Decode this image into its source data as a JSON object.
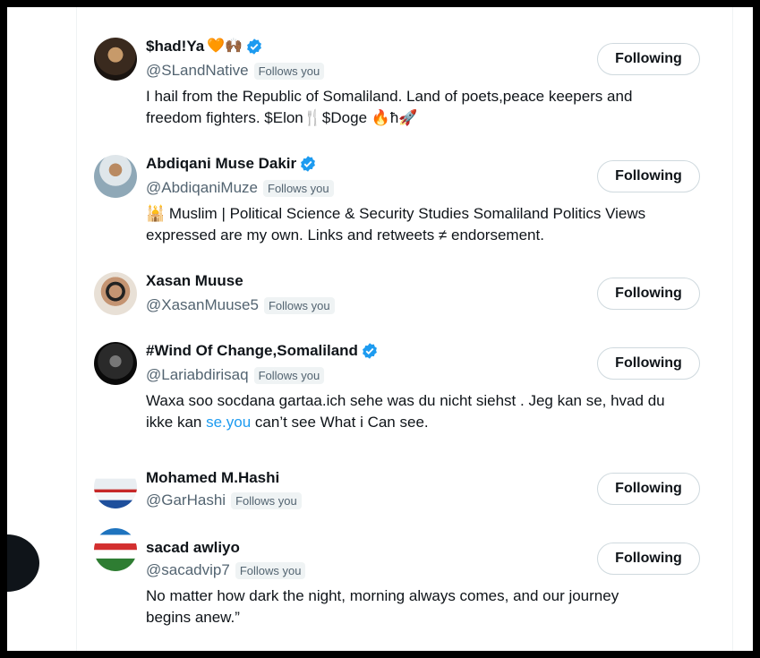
{
  "colors": {
    "accent": "#1d9bf0",
    "text": "#0f1419",
    "muted": "#536471",
    "badge_bg": "#eff3f4"
  },
  "follow_button_label": "Following",
  "follows_you_label": "Follows you",
  "users": [
    {
      "name": "$had!Ya",
      "name_emoji": "🧡🙌🏾",
      "handle": "@SLandNative",
      "verified": true,
      "bio_1": "I hail from the Republic of Somaliland. Land of poets,peace keepers and",
      "bio_2": "freedom fighters. $Elon🍴$Doge 🔥ħ🚀"
    },
    {
      "name": "Abdiqani Muse Dakir",
      "name_emoji": "",
      "handle": "@AbdiqaniMuze",
      "verified": true,
      "bio_1": "🕌 Muslim | Political Science & Security Studies Somaliland Politics Views",
      "bio_2": "expressed are my own. Links and retweets ≠ endorsement."
    },
    {
      "name": "Xasan Muuse",
      "name_emoji": "",
      "handle": "@XasanMuuse5",
      "verified": false,
      "bio_1": "",
      "bio_2": ""
    },
    {
      "name": "#Wind Of Change,Somaliland",
      "name_emoji": "",
      "handle": "@Lariabdirisaq",
      "verified": true,
      "bio_1": "Waxa soo socdana gartaa.ich sehe was du nicht siehst . Jeg kan se, hvad du",
      "bio_2_pre": "ikke kan ",
      "bio_2_link": "se.you",
      "bio_2_post": " can’t see What i Can see."
    },
    {
      "name": "Mohamed M.Hashi",
      "name_emoji": "",
      "handle": "@GarHashi",
      "verified": false,
      "bio_1": "",
      "bio_2": ""
    },
    {
      "name": "sacad awliyo",
      "name_emoji": "",
      "handle": "@sacadvip7",
      "verified": false,
      "bio_1": "No matter how dark the night, morning always comes, and our journey",
      "bio_2": "begins anew.”"
    }
  ]
}
